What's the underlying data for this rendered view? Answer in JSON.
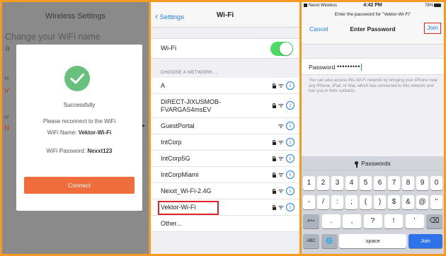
{
  "panel1": {
    "title": "Wireless Settings",
    "bg_line1": "Change your WiFi name",
    "bg_line2": "a",
    "bg_w1": "W",
    "bg_r1": "V",
    "bg_w2": "W",
    "bg_r2": "N",
    "modal": {
      "success": "Successfully",
      "please": "Please reconnect to the WiFi",
      "name_label": "WiFi Name: ",
      "name_value": "Vektor-Wi-Fi",
      "pass_label": "WiFi Password: ",
      "pass_value": "Nexxt123",
      "connect": "Connect"
    }
  },
  "panel2": {
    "back": "Settings",
    "title": "Wi-Fi",
    "wifi_label": "Wi-Fi",
    "wifi_on": true,
    "choose": "CHOOSE A NETWORK...",
    "networks": [
      {
        "name": "A",
        "locked": true
      },
      {
        "name": "DIRECT-JIXUSMOB-FVARGAS4msEV",
        "line1": "DIRECT-JIXUSMOB-",
        "line2": "FVARGAS4msEV",
        "locked": true
      },
      {
        "name": "GuestPortal",
        "locked": false
      },
      {
        "name": "IntCorp",
        "locked": true
      },
      {
        "name": "IntCorp5G",
        "locked": true
      },
      {
        "name": "IntCorpMiami",
        "locked": true
      },
      {
        "name": "Nexxt_Wi-Fi-2.4G",
        "locked": true
      },
      {
        "name": "Vektor-Wi-Fi",
        "locked": true,
        "highlighted": true
      },
      {
        "name": "Other...",
        "locked": false
      }
    ]
  },
  "panel3": {
    "carrier": "Nexxt Wireless",
    "time": "4:42 PM",
    "battery": "78%",
    "prompt": "Enter the password for \"Vektor-Wi-Fi\"",
    "cancel": "Cancel",
    "title": "Enter Password",
    "join": "Join",
    "password_label": "Password",
    "password_mask": "•••••••••",
    "help": "You can also access this Wi-Fi network by bringing your iPhone near any iPhone, iPad, or Mac which has connected to this network and has you in their contacts.",
    "keyboard": {
      "passwords": "Passwords",
      "row1": [
        "1",
        "2",
        "3",
        "4",
        "5",
        "6",
        "7",
        "8",
        "9",
        "0"
      ],
      "row2": [
        "-",
        "/",
        ":",
        ";",
        "(",
        ")",
        "$",
        "&",
        "@",
        "\""
      ],
      "row3_left": "#+=",
      "row3": [
        ".",
        ",",
        "?",
        "!",
        "'"
      ],
      "row3_right": "⌫",
      "abc": "ABC",
      "globe": "🌐",
      "space": "space",
      "join": "Join"
    }
  }
}
